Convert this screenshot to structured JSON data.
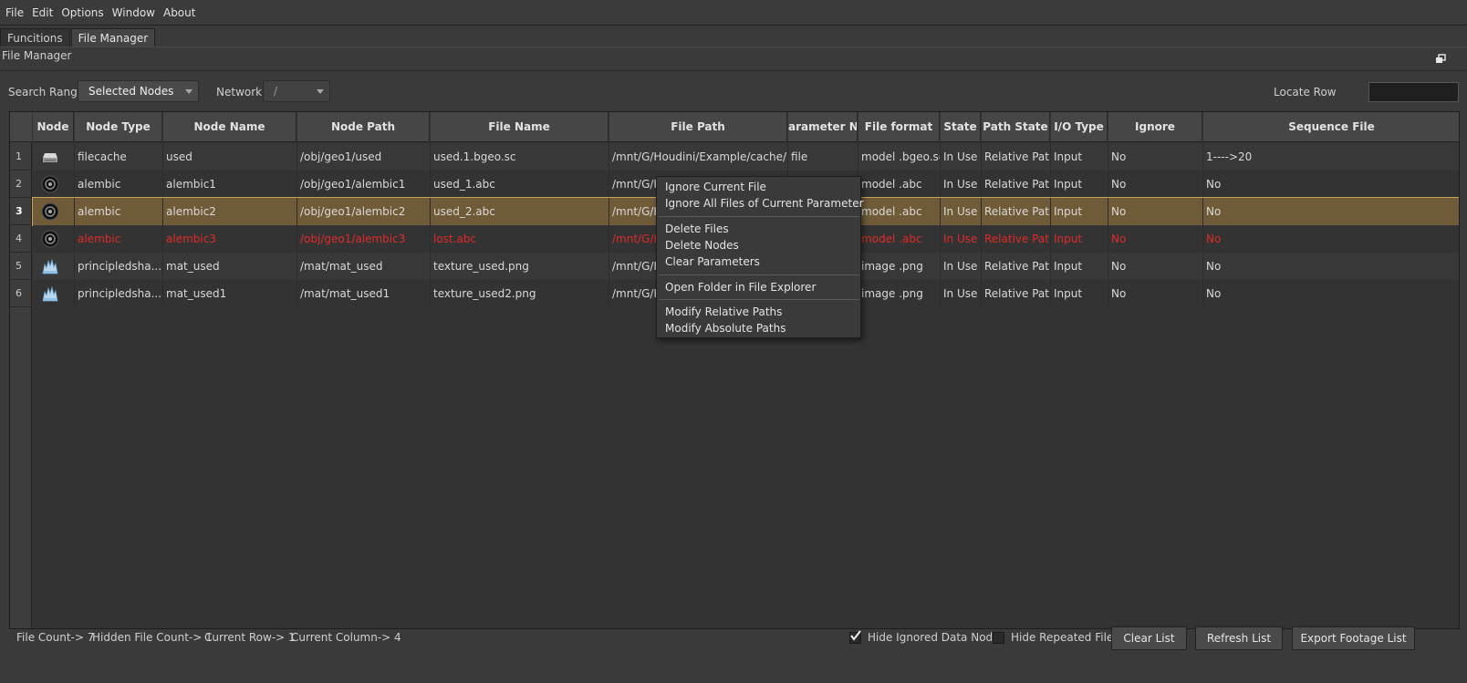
{
  "menu": [
    "File",
    "Edit",
    "Options",
    "Window",
    "About"
  ],
  "tabs": [
    "Funcitions",
    "File Manager"
  ],
  "panel": {
    "title": "File Manager"
  },
  "filters": {
    "search_range_label": "Search Range",
    "search_range_value": "Selected Nodes",
    "network_label": "Network",
    "network_value": "/",
    "locate_row_label": "Locate Row",
    "locate_row_value": ""
  },
  "table": {
    "columns": [
      "Node",
      "Node Type",
      "Node Name",
      "Node Path",
      "File Name",
      "File Path",
      "arameter Nan",
      "File format",
      "State",
      "Path State",
      "I/O Type",
      "Ignore",
      "Sequence File"
    ],
    "rows": [
      {
        "num": "1",
        "icon": "filecache-icon",
        "type": "filecache",
        "name": "used",
        "path": "/obj/geo1/used",
        "file": "used.1.bgeo.sc",
        "filepath": "/mnt/G/Houdini/Example/cache/...",
        "param": "file",
        "format": "model .bgeo.sc",
        "state": "In Use",
        "pathstate": "Relative Path",
        "io": "Input",
        "ignore": "No",
        "seq": "1---->20"
      },
      {
        "num": "2",
        "icon": "alembic-icon",
        "type": "alembic",
        "name": "alembic1",
        "path": "/obj/geo1/alembic1",
        "file": "used_1.abc",
        "filepath": "/mnt/G/H",
        "param": "",
        "format": "model .abc",
        "state": "In Use",
        "pathstate": "Relative Path",
        "io": "Input",
        "ignore": "No",
        "seq": "No"
      },
      {
        "num": "3",
        "icon": "alembic-icon",
        "type": "alembic",
        "name": "alembic2",
        "path": "/obj/geo1/alembic2",
        "file": "used_2.abc",
        "filepath": "/mnt/G/H",
        "param": "",
        "format": "model .abc",
        "state": "In Use",
        "pathstate": "Relative Path",
        "io": "Input",
        "ignore": "No",
        "seq": "No"
      },
      {
        "num": "4",
        "icon": "alembic-icon",
        "type": "alembic",
        "name": "alembic3",
        "path": "/obj/geo1/alembic3",
        "file": "lost.abc",
        "filepath": "/mnt/G/H",
        "param": "",
        "format": "model .abc",
        "state": "In Use",
        "pathstate": "Relative Path",
        "io": "Input",
        "ignore": "No",
        "seq": "No"
      },
      {
        "num": "5",
        "icon": "principled-shader-icon",
        "type": "principledsha...",
        "name": "mat_used",
        "path": "/mat/mat_used",
        "file": "texture_used.png",
        "filepath": "/mnt/G/H",
        "param": "",
        "format": "image .png",
        "state": "In Use",
        "pathstate": "Relative Path",
        "io": "Input",
        "ignore": "No",
        "seq": "No"
      },
      {
        "num": "6",
        "icon": "principled-shader-icon",
        "type": "principledsha...",
        "name": "mat_used1",
        "path": "/mat/mat_used1",
        "file": "texture_used2.png",
        "filepath": "/mnt/G/H",
        "param": "",
        "format": "image .png",
        "state": "In Use",
        "pathstate": "Relative Path",
        "io": "Input",
        "ignore": "No",
        "seq": "No"
      }
    ]
  },
  "context_menu": {
    "items": [
      "Ignore Current File",
      "Ignore All Files of Current Parameter",
      "Delete Files",
      "Delete Nodes",
      "Clear Parameters",
      "Open Folder in File Explorer",
      "Modify Relative Paths",
      "Modify Absolute Paths"
    ]
  },
  "status": {
    "file_count": "File Count-> 7",
    "hidden_count": "Hidden File Count-> 1",
    "current_row": "Current Row-> 1",
    "current_column": "Current Column-> 4"
  },
  "options": {
    "hide_ignored_label": "Hide Ignored Data Node",
    "hide_ignored_checked": true,
    "hide_repeated_label": "Hide Repeated File",
    "hide_repeated_checked": false
  },
  "buttons": {
    "clear": "Clear List",
    "refresh": "Refresh List",
    "export": "Export Footage List"
  },
  "colors": {
    "selected_row": "#6f5b37",
    "lost_text": "#e02a2a",
    "background": "#3a3a3a"
  }
}
